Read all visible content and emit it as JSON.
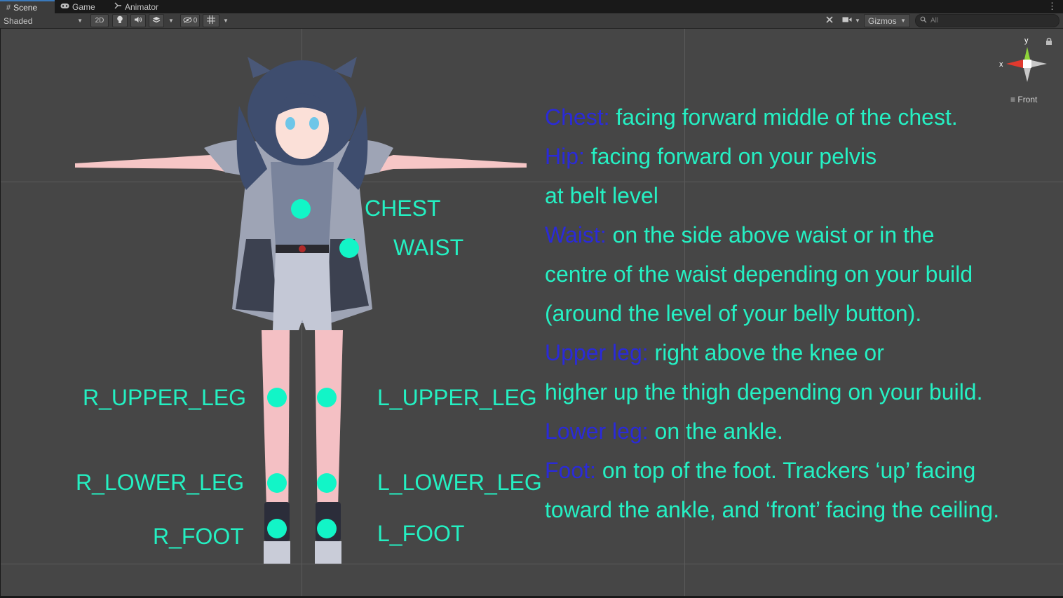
{
  "tabs": [
    {
      "label": "Scene",
      "icon": "grid-hash-icon"
    },
    {
      "label": "Game",
      "icon": "gamepad-icon"
    },
    {
      "label": "Animator",
      "icon": "animator-icon"
    }
  ],
  "toolbar": {
    "draw_mode": "Shaded",
    "mode_2d": "2D",
    "hidden_count": "0",
    "gizmos_label": "Gizmos",
    "search_placeholder": "All"
  },
  "gizmo": {
    "y_label": "y",
    "x_label": "x",
    "view_label": "Front",
    "colors": {
      "x": "#e0392e",
      "y": "#8fd33a",
      "z": "#c9c9c9"
    }
  },
  "labels": {
    "chest": "CHEST",
    "waist": "WAIST",
    "r_upper_leg": "R_UPPER_LEG",
    "l_upper_leg": "L_UPPER_LEG",
    "r_lower_leg": "R_LOWER_LEG",
    "l_lower_leg": "L_LOWER_LEG",
    "r_foot": "R_FOOT",
    "l_foot": "L_FOOT"
  },
  "instructions": [
    {
      "kw": "Chest:",
      "text": " facing forward middle of the chest."
    },
    {
      "kw": "Hip:",
      "text": " facing forward on your pelvis"
    },
    {
      "kw": "",
      "text": "at belt level"
    },
    {
      "kw": "Waist:",
      "text": " on the side above waist or in the"
    },
    {
      "kw": "",
      "text": "centre of the waist depending on your build"
    },
    {
      "kw": "",
      "text": "(around the level of your belly button)."
    },
    {
      "kw": "Upper leg:",
      "text": " right above the knee or"
    },
    {
      "kw": "",
      "text": "higher up the thigh depending on your build."
    },
    {
      "kw": "Lower leg:",
      "text": " on the ankle."
    },
    {
      "kw": "Foot:",
      "text": " on top of the foot. Trackers ‘up’ facing"
    },
    {
      "kw": "",
      "text": "toward the ankle, and ‘front’ facing the ceiling."
    }
  ],
  "colors": {
    "accent_text": "#25f1c4",
    "keyword_text": "#2a2ad8",
    "tracker_dot": "#12f5c7",
    "viewport_bg": "#464646"
  }
}
